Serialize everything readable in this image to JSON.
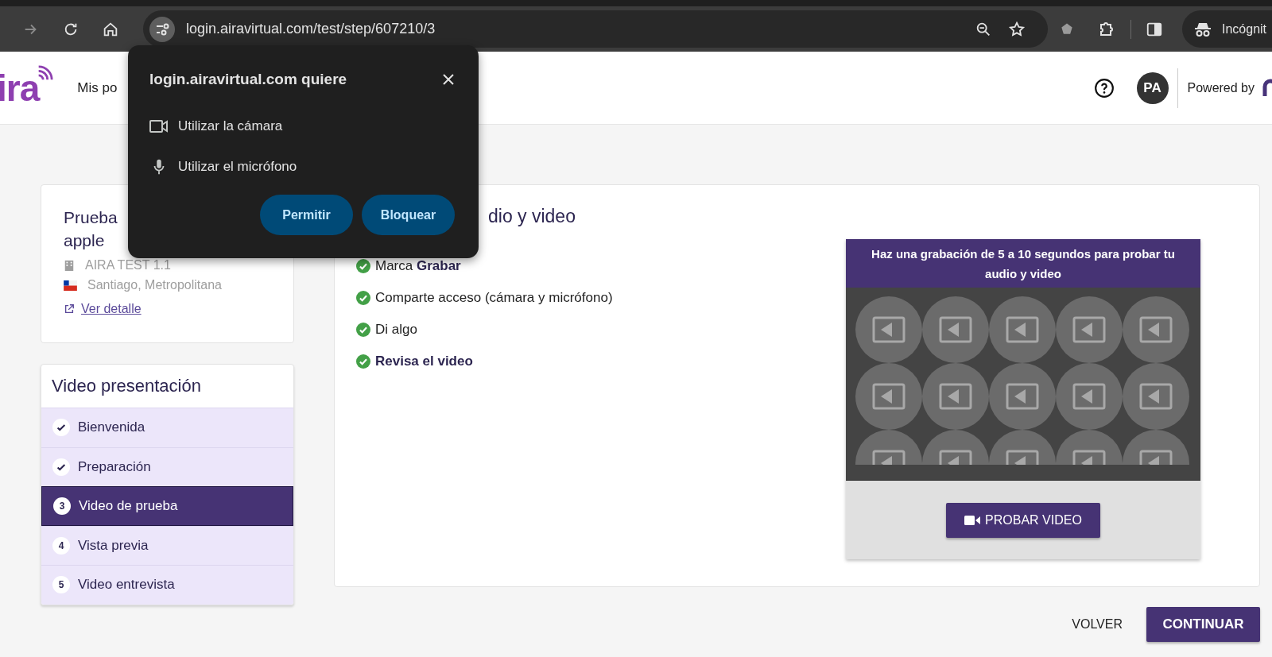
{
  "browser": {
    "url": "login.airavirtual.com/test/step/607210/3",
    "incognito_label": "Incógnit"
  },
  "header": {
    "logo": "ira",
    "nav_label": "Mis po",
    "avatar": "PA",
    "powered_by": "Powered by"
  },
  "popup": {
    "title": "login.airavirtual.com quiere",
    "permissions": [
      {
        "kind": "camera",
        "label": "Utilizar la cámara"
      },
      {
        "kind": "microphone",
        "label": "Utilizar el micrófono"
      }
    ],
    "buttons": [
      "Permitir",
      "Bloquear"
    ]
  },
  "job_card": {
    "title_lines": [
      "Prueba",
      "apple"
    ],
    "company": "AIRA TEST 1.1",
    "location": "Santiago, Metropolitana",
    "link": "Ver detalle"
  },
  "steps": {
    "title": "Video presentación",
    "items": [
      {
        "kind": "done",
        "label": "Bienvenida",
        "selected": false
      },
      {
        "kind": "done",
        "label": "Preparación",
        "selected": false
      },
      {
        "kind": "numbered",
        "number": "3",
        "label": "Video de prueba",
        "selected": true
      },
      {
        "kind": "numbered",
        "number": "4",
        "label": "Vista previa",
        "selected": false
      },
      {
        "kind": "numbered",
        "number": "5",
        "label": "Video entrevista",
        "selected": false
      }
    ]
  },
  "main": {
    "title": "dio y video",
    "instructions": [
      {
        "text": "Marca **Grabar**",
        "bold": false
      },
      {
        "text": "Comparte acceso (cámara y micrófono)",
        "bold": false
      },
      {
        "text": "Di algo",
        "bold": false
      },
      {
        "text": "Revisa el video",
        "bold": true
      }
    ]
  },
  "recorder": {
    "prompt": "Haz una grabación de 5 a 10 segundos para probar tu audio y video",
    "button": "PROBAR VIDEO"
  },
  "footer": {
    "back": "VOLVER",
    "next": "CONTINUAR"
  }
}
